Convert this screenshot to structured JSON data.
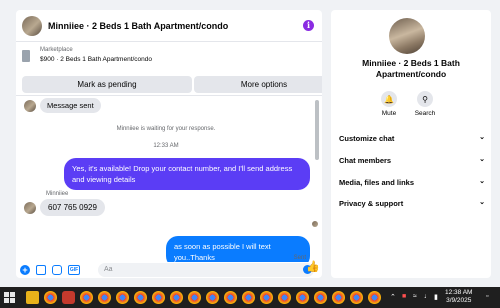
{
  "chat": {
    "title": "Minniiee · 2 Beds 1 Bath Apartment/condo",
    "listing": {
      "label": "Marketplace",
      "price_title": "$900 · 2 Beds 1 Bath Apartment/condo",
      "mark_pending_label": "Mark as pending",
      "more_options_label": "More options"
    },
    "messages": {
      "message_sent": "Message sent",
      "waiting_note": "Minniiee is waiting for your response.",
      "timestamp": "12:33 AM",
      "outgoing_1": "Yes, it's available! Drop your contact number, and I'll send address and viewing details",
      "sender_name": "Minniiee",
      "incoming_phone": "607 765 0929",
      "outgoing_2": "as soon as possible I will text you..Thanks",
      "status": "Sent"
    },
    "composer": {
      "placeholder": "Aa",
      "gif_label": "GIF"
    }
  },
  "side": {
    "title": "Minniiee · 2 Beds 1 Bath Apartment/condo",
    "actions": [
      {
        "label": "Mute",
        "icon": "bell-icon"
      },
      {
        "label": "Search",
        "icon": "search-icon"
      }
    ],
    "sections": [
      "Customize chat",
      "Chat members",
      "Media, files and links",
      "Privacy & support"
    ]
  },
  "taskbar": {
    "time": "12:38 AM",
    "date": "3/9/2025"
  },
  "colors": {
    "outgoing_bubble": "#5b3df5",
    "outgoing_bubble_2": "#0a7cff",
    "accent": "#0a7cff",
    "info_icon": "#8a2be2"
  }
}
